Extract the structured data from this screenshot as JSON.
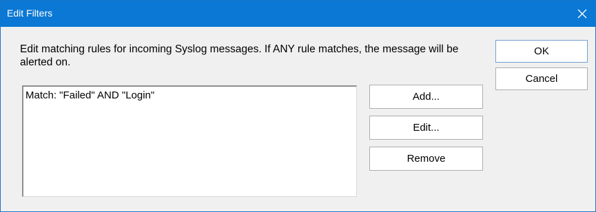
{
  "window": {
    "title": "Edit Filters",
    "close_icon": "close-icon",
    "colors": {
      "titlebar": "#0a78d4",
      "title_text": "#ffffff",
      "background": "#f0f0f0"
    }
  },
  "dialog": {
    "description": "Edit matching rules for incoming Syslog messages.  If ANY rule matches, the message will be alerted on.",
    "rules": [
      "Match: \"Failed\" AND \"Login\""
    ],
    "buttons": {
      "add": "Add...",
      "edit": "Edit...",
      "remove": "Remove",
      "ok": "OK",
      "cancel": "Cancel"
    }
  }
}
